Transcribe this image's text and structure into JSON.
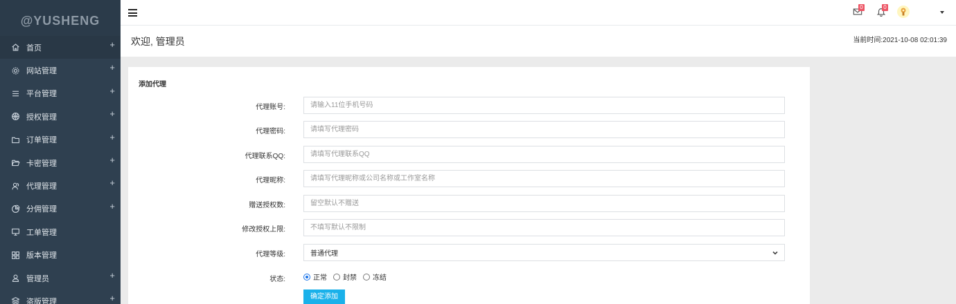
{
  "sidebar": {
    "logo": "@YUSHENG",
    "items": [
      {
        "label": "首页",
        "icon": "home-icon",
        "has_plus": true
      },
      {
        "label": "网站管理",
        "icon": "gear-icon",
        "has_plus": true
      },
      {
        "label": "平台管理",
        "icon": "list-icon",
        "has_plus": true
      },
      {
        "label": "授权管理",
        "icon": "basketball-icon",
        "has_plus": true
      },
      {
        "label": "订单管理",
        "icon": "folder-icon",
        "has_plus": true
      },
      {
        "label": "卡密管理",
        "icon": "folder-open-icon",
        "has_plus": true
      },
      {
        "label": "代理管理",
        "icon": "users-icon",
        "has_plus": true
      },
      {
        "label": "分佣管理",
        "icon": "pie-chart-icon",
        "has_plus": true
      },
      {
        "label": "工单管理",
        "icon": "monitor-icon",
        "has_plus": false
      },
      {
        "label": "版本管理",
        "icon": "grid-icon",
        "has_plus": false
      },
      {
        "label": "管理员",
        "icon": "user-icon",
        "has_plus": true
      },
      {
        "label": "盗版管理",
        "icon": "layers-icon",
        "has_plus": true
      }
    ],
    "plus_symbol": "+"
  },
  "topbar": {
    "mail_badge": "0",
    "bell_badge": "0"
  },
  "header": {
    "welcome": "欢迎, 管理员",
    "time": "当前时间:2021-10-08 02:01:39"
  },
  "form": {
    "title": "添加代理",
    "account": {
      "label": "代理账号:",
      "placeholder": "请输入11位手机号码"
    },
    "password": {
      "label": "代理密码:",
      "placeholder": "请填写代理密码"
    },
    "qq": {
      "label": "代理联系QQ:",
      "placeholder": "请填写代理联系QQ"
    },
    "nickname": {
      "label": "代理昵称:",
      "placeholder": "请填写代理昵称或公司名称或工作室名称"
    },
    "gift": {
      "label": "赠送授权数:",
      "placeholder": "留空默认不赠送"
    },
    "limit": {
      "label": "修改授权上限:",
      "placeholder": "不填写默认不限制"
    },
    "level": {
      "label": "代理等级:",
      "value": "普通代理"
    },
    "status": {
      "label": "状态:",
      "options": [
        "正常",
        "封禁",
        "冻结"
      ],
      "selected": "正常"
    },
    "submit": "确定添加"
  },
  "colors": {
    "sidebar_bg": "#2f4050",
    "accent": "#1ab1ea",
    "badge": "#ed5565"
  }
}
